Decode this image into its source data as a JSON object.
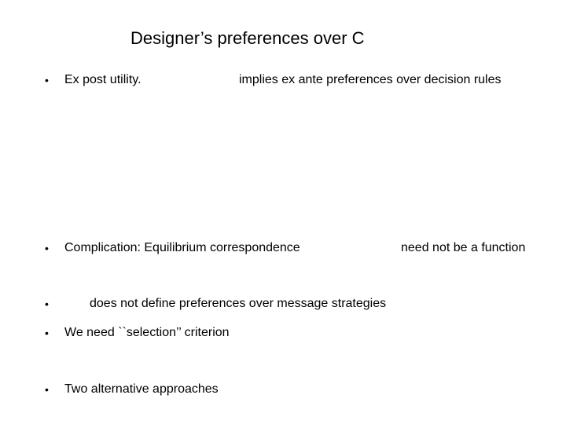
{
  "slide": {
    "title": "Designer’s preferences over C",
    "bullets": [
      {
        "marker": "•",
        "segments": [
          "Ex post utility.",
          "implies ex ante preferences over decision rules"
        ]
      },
      {
        "marker": "•",
        "segments": [
          "Complication: Equilibrium correspondence",
          "need not be a function"
        ]
      },
      {
        "marker": "•",
        "segments": [
          "does not define preferences over message strategies"
        ]
      },
      {
        "marker": "•",
        "segments": [
          "We need ``selection’’ criterion"
        ]
      },
      {
        "marker": "•",
        "segments": [
          "Two alternative approaches"
        ]
      }
    ]
  }
}
